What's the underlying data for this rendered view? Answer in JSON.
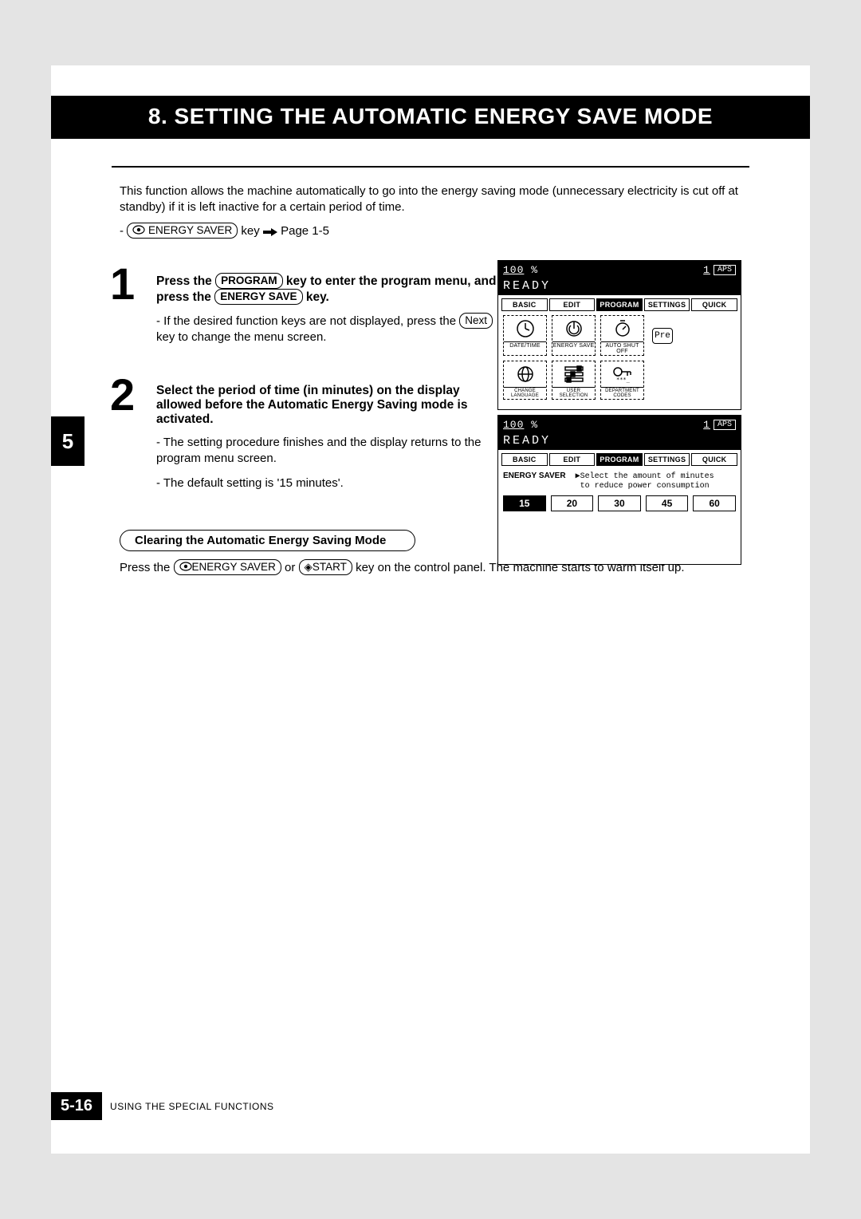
{
  "title": "8. SETTING THE AUTOMATIC ENERGY SAVE MODE",
  "intro": "This function allows the machine automatically to go into the energy saving mode (unnecessary electricity is cut off at standby) if it is left inactive for a certain period of time.",
  "intro_key_prefix": "- ",
  "intro_key_label": "ENERGY SAVER",
  "intro_key_suffix": " key ",
  "intro_key_page": " Page 1-5",
  "step1": {
    "num": "1",
    "line1a": "Press the ",
    "key1": "PROGRAM",
    "line1b": " key to enter the program menu, and press the ",
    "key2": "ENERGY SAVE",
    "line1c": " key.",
    "sub_prefix": "- If the desired function keys are not displayed, press the ",
    "sub_key": "Next",
    "sub_suffix": " key to change the menu screen."
  },
  "step2": {
    "num": "2",
    "bold": "Select the period of time (in minutes) on the display allowed before the Automatic Energy Saving mode is activated.",
    "sub1": "- The setting procedure finishes and the display returns to the program menu screen.",
    "sub2": "- The default setting is '15 minutes'."
  },
  "side_tab": "5",
  "screen_top": {
    "pct": "100",
    "pct_sym": "%",
    "copies": "1",
    "aps": "APS",
    "ready": "READY",
    "tabs": [
      "BASIC",
      "EDIT",
      "PROGRAM",
      "SETTINGS",
      "QUICK"
    ],
    "selected_tab": 2,
    "icons_row1": [
      {
        "name": "date-time-icon",
        "label": "DATE/TIME"
      },
      {
        "name": "energy-save-icon",
        "label": "ENERGY SAVE"
      },
      {
        "name": "auto-shutoff-icon",
        "label": "AUTO SHUT OFF"
      }
    ],
    "pre": "Pre",
    "icons_row2": [
      {
        "name": "change-language-icon",
        "label": "CHANGE LANGUAGE"
      },
      {
        "name": "user-selection-icon",
        "label": "USER SELECTION"
      },
      {
        "name": "department-codes-icon",
        "label": "DEPARTMENT CODES"
      }
    ]
  },
  "screen2": {
    "pct": "100",
    "pct_sym": "%",
    "copies": "1",
    "aps": "APS",
    "ready": "READY",
    "tabs": [
      "BASIC",
      "EDIT",
      "PROGRAM",
      "SETTINGS",
      "QUICK"
    ],
    "selected_tab": 2,
    "label": "ENERGY SAVER",
    "prompt1": "▶Select the amount of minutes",
    "prompt2": "  to reduce power consumption",
    "options": [
      "15",
      "20",
      "30",
      "45",
      "60"
    ],
    "selected": 0
  },
  "clearing": {
    "heading": "Clearing the Automatic Energy Saving Mode",
    "t1": "Press the ",
    "k1": "ENERGY SAVER",
    "t2": " or ",
    "k2": "START",
    "t3": " key on the control panel. The machine starts to warm itself up."
  },
  "footer": {
    "page": "5-16",
    "chapter": "USING THE SPECIAL FUNCTIONS"
  }
}
